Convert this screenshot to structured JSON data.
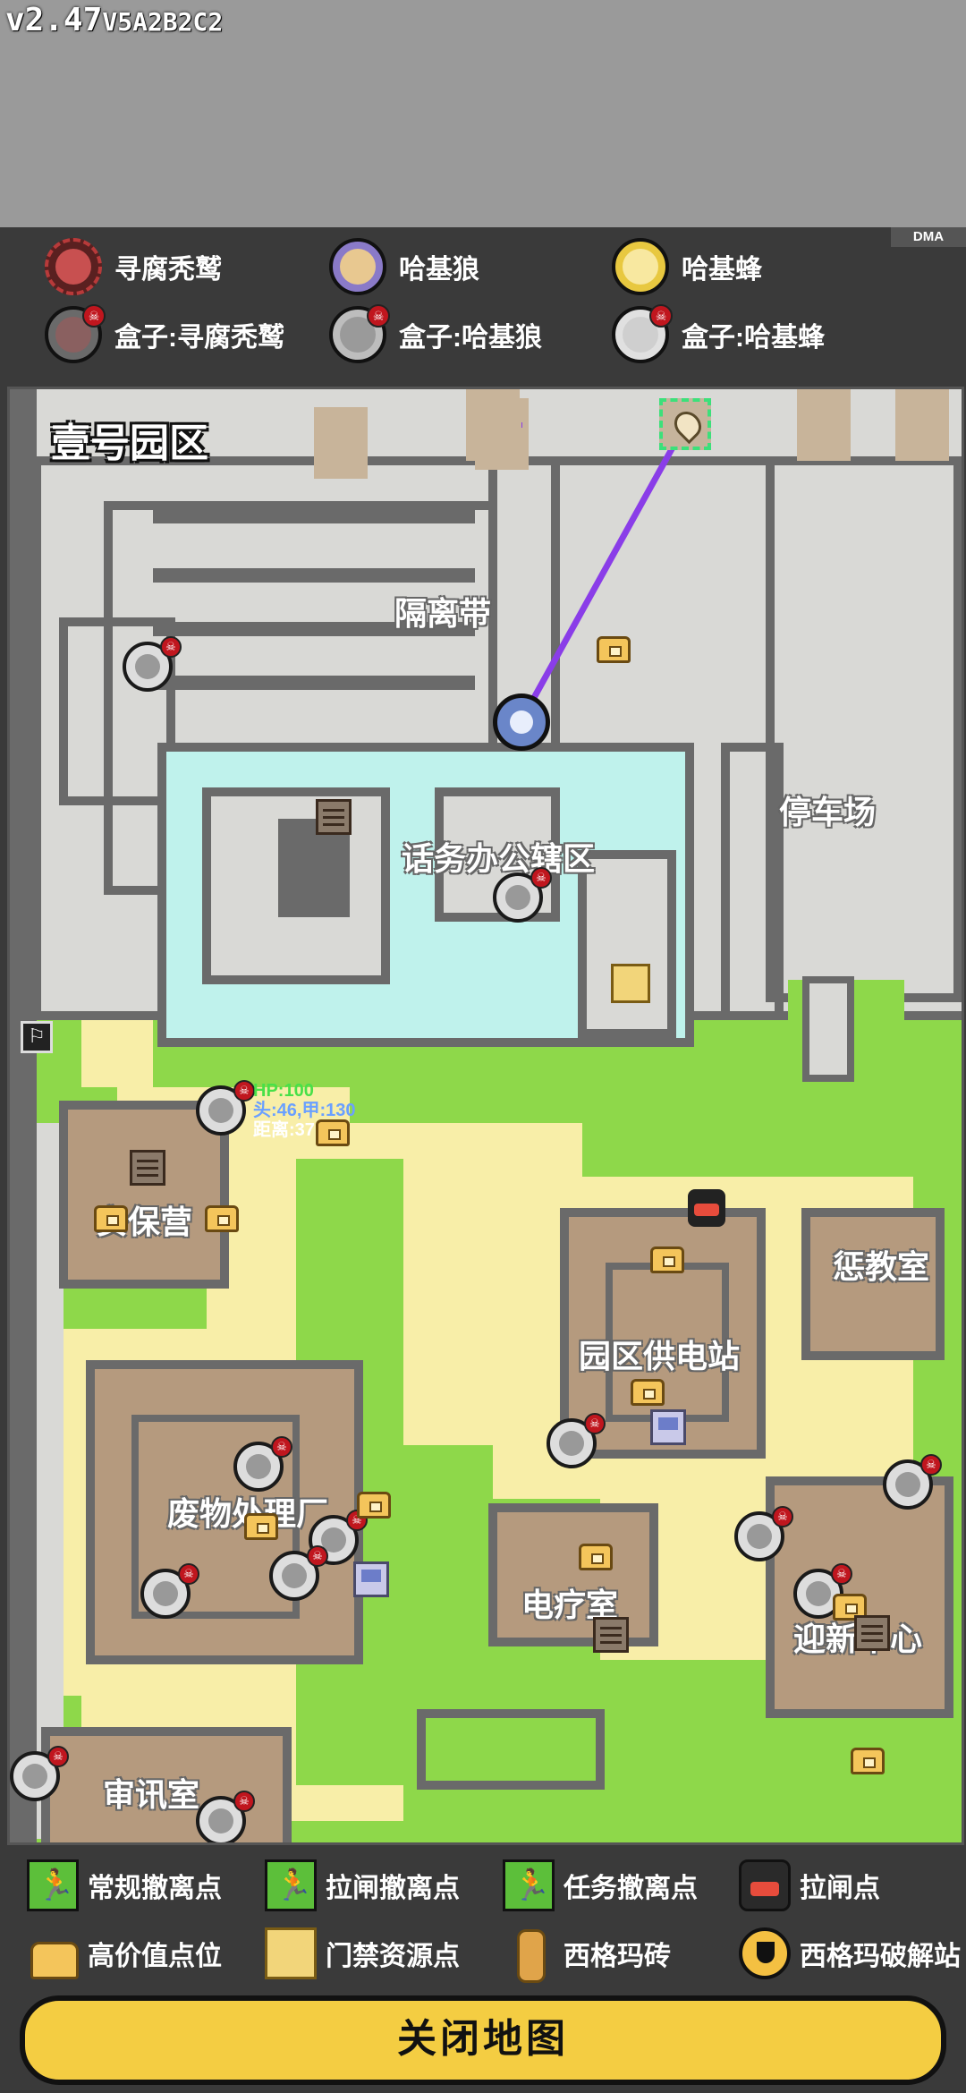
{
  "version": {
    "main": "v2.47",
    "build": "V5A2B2C2"
  },
  "badge": "DMA",
  "top_legend": [
    {
      "label": "寻腐秃鹫",
      "color": "#b83a3a"
    },
    {
      "label": "哈基狼",
      "color": "#8a7ac8"
    },
    {
      "label": "哈基蜂",
      "color": "#e8c840"
    },
    {
      "label": "盒子:寻腐秃鹫",
      "color": "#8a6060"
    },
    {
      "label": "盒子:哈基狼",
      "color": "#9a9a9a"
    },
    {
      "label": "盒子:哈基蜂",
      "color": "#cfcfcf"
    }
  ],
  "map": {
    "zone_title": "壹号园区",
    "areas": [
      "隔离带",
      "话务办公辖区",
      "停车场",
      "安保营",
      "惩教室",
      "园区供电站",
      "废物处理厂",
      "电疗室",
      "迎新中心",
      "审讯室"
    ],
    "player_stats": {
      "hp": "HP:100",
      "armor": "头:46,甲:130",
      "distance": "距离:37"
    }
  },
  "bottom_legend": {
    "normal_extract": "常规撤离点",
    "lever_extract": "拉闸撤离点",
    "mission_extract": "任务撤离点",
    "lever_point": "拉闸点",
    "high_value": "高价值点位",
    "access_resource": "门禁资源点",
    "sigma_brick": "西格玛砖",
    "sigma_crack": "西格玛破解站"
  },
  "close_button": "关闭地图"
}
